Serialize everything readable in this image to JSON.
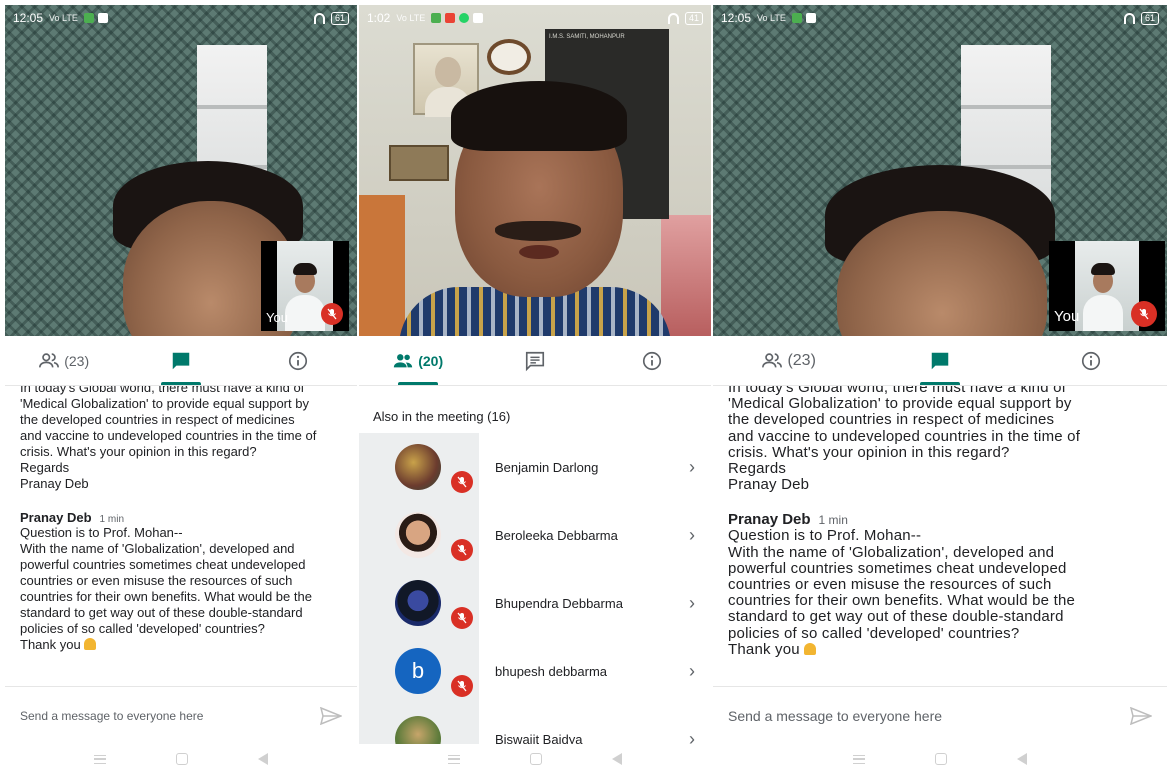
{
  "screens": [
    {
      "status": {
        "time": "12:05",
        "signal": "Vo LTE",
        "battery": "61"
      },
      "self_label": "You",
      "tabs": [
        {
          "icon": "people-icon",
          "count": "(23)"
        },
        {
          "icon": "chat-icon"
        },
        {
          "icon": "info-icon"
        }
      ],
      "chat": {
        "cut_line": "In today's Global world, there must have a kind of",
        "lines": [
          "'Medical Globalization' to provide equal support by",
          "the developed countries in respect of medicines",
          "and vaccine to undeveloped countries in the time of",
          "crisis. What's your opinion in this regard?",
          "Regards",
          "Pranay Deb"
        ],
        "message": {
          "sender": "Pranay Deb",
          "time": "1 min",
          "lines": [
            "Question is to Prof. Mohan--",
            "With the name of 'Globalization', developed and",
            "powerful countries sometimes cheat undeveloped",
            "countries or even misuse the resources of such",
            "countries for their own benefits. What would be the",
            "standard to get way out of these double-standard",
            "policies of so called 'developed' countries?",
            "Thank you"
          ]
        }
      },
      "composer": {
        "placeholder": "Send a message to everyone here"
      }
    },
    {
      "status": {
        "time": "1:02",
        "signal": "Vo LTE",
        "battery": "41"
      },
      "board_text": "I.M.S. SAMITI, MOHANPUR",
      "tabs": [
        {
          "icon": "people-icon",
          "count": "(20)"
        },
        {
          "icon": "chat-icon"
        },
        {
          "icon": "info-icon"
        }
      ],
      "meeting_label": "Also in the meeting (16)",
      "participants": [
        {
          "name": "Benjamin Darlong"
        },
        {
          "name": "Beroleeka Debbarma"
        },
        {
          "name": "Bhupendra Debbarma"
        },
        {
          "name": "bhupesh debbarma",
          "initial": "b"
        },
        {
          "name": "Biswajit Baidya"
        }
      ]
    },
    {
      "status": {
        "time": "12:05",
        "signal": "Vo LTE",
        "battery": "61"
      },
      "self_label": "You",
      "tabs": [
        {
          "icon": "people-icon",
          "count": "(23)"
        },
        {
          "icon": "chat-icon"
        },
        {
          "icon": "info-icon"
        }
      ],
      "chat": {
        "cut_line": "In today's Global world, there must have a kind of",
        "lines": [
          "'Medical Globalization' to provide equal support by",
          "the developed countries in respect of medicines",
          "and vaccine to undeveloped countries in the time of",
          "crisis. What's your opinion in this regard?",
          "Regards",
          "Pranay Deb"
        ],
        "message": {
          "sender": "Pranay Deb",
          "time": "1 min",
          "lines": [
            "Question is to Prof. Mohan--",
            "With the name of 'Globalization', developed and",
            "powerful countries sometimes cheat undeveloped",
            "countries or even misuse the resources of such",
            "countries for their own benefits. What would be the",
            "standard to get way out of these double-standard",
            "policies of so called 'developed' countries?",
            "Thank you"
          ]
        }
      },
      "composer": {
        "placeholder": "Send a message to everyone here"
      }
    }
  ],
  "colors": {
    "accent": "#00796b",
    "mic_off": "#d93025",
    "avatar_b": "#1565c0"
  }
}
